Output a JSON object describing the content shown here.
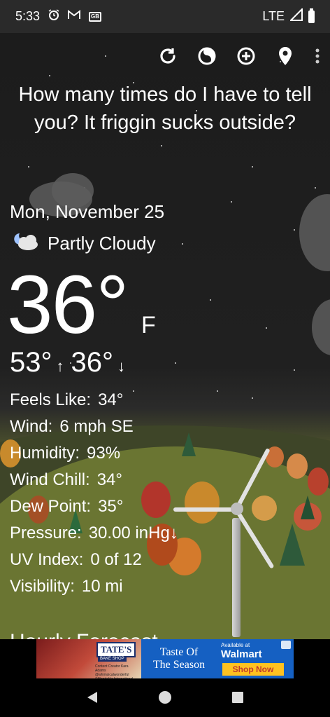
{
  "status_bar": {
    "time": "5:33",
    "network": "LTE",
    "icons": [
      "alarm-icon",
      "gmail-icon",
      "gb-icon",
      "signal-icon",
      "battery-icon"
    ],
    "gb_label": "GB"
  },
  "toolbar": {
    "icons": [
      "refresh-icon",
      "theme-icon",
      "add-location-icon",
      "location-pin-icon",
      "more-options-icon"
    ]
  },
  "weather": {
    "message": "How many times do I have to tell you? It friggin sucks outside?",
    "date": "Mon, November 25",
    "condition": "Partly Cloudy",
    "condition_icon": "partly-cloudy-night-icon",
    "temperature": "36°",
    "unit": "F",
    "high": "53°",
    "high_arrow": "↑",
    "low": "36°",
    "low_arrow": "↓",
    "details": [
      {
        "label": "Feels Like:",
        "value": "34°"
      },
      {
        "label": "Wind:",
        "value": "6 mph SE"
      },
      {
        "label": "Humidity:",
        "value": "93%"
      },
      {
        "label": "Wind Chill:",
        "value": "34°"
      },
      {
        "label": "Dew Point:",
        "value": "35°"
      },
      {
        "label": "Pressure:",
        "value": "30.00 inHg↓"
      },
      {
        "label": "UV Index:",
        "value": "0 of 12"
      },
      {
        "label": "Visibility:",
        "value": "10 mi"
      }
    ],
    "next_heading": "Hourly Forecast"
  },
  "ad": {
    "brand": "TATE'S",
    "brand_sub": "BAKE SHOP",
    "fine_print": "Content Creator Kara Adams @whimsicalwonderful ©Mondelēz International group",
    "headline_1": "Taste Of",
    "headline_2": "The Season",
    "available": "Available at",
    "retailer": "Walmart",
    "cta": "Shop Now"
  },
  "nav": {
    "icons": [
      "back-icon",
      "home-icon",
      "recents-icon"
    ]
  },
  "colors": {
    "status_bar_bg": "#2a2a2a",
    "sky": "#1e1e1e",
    "grass": "#6a7532",
    "ad_blue": "#1560c2",
    "walmart_yellow": "#ffc220"
  }
}
